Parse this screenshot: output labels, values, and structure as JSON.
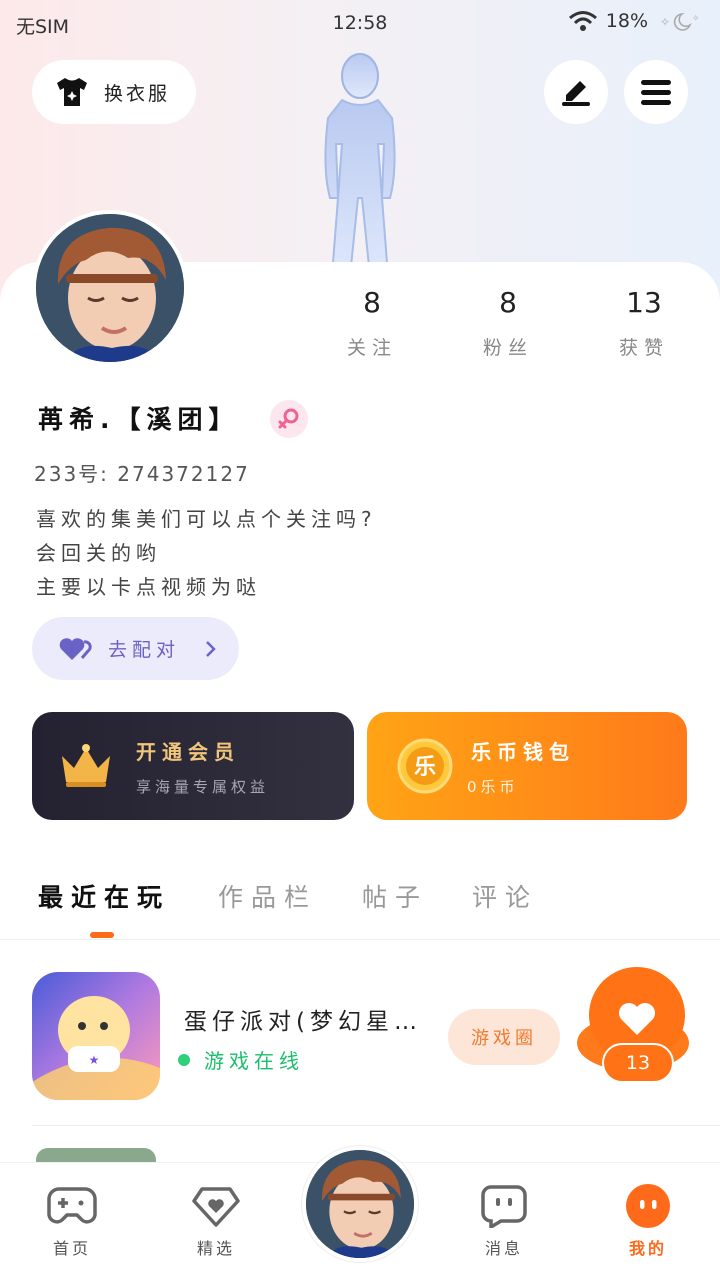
{
  "status_bar": {
    "carrier": "无SIM",
    "time": "12:58",
    "battery": "18%"
  },
  "header": {
    "outfit_label": "换衣服"
  },
  "profile": {
    "stats": [
      {
        "value": "8",
        "label": "关注"
      },
      {
        "value": "8",
        "label": "粉丝"
      },
      {
        "value": "13",
        "label": "获赞"
      }
    ],
    "name": "苒希.【溪团】",
    "uid": "233号: 274372127",
    "bio": [
      "喜欢的集美们可以点个关注吗?",
      "会回关的哟",
      "主要以卡点视频为哒"
    ],
    "match_label": "去配对"
  },
  "cards": {
    "vip": {
      "title": "开通会员",
      "subtitle": "享海量专属权益"
    },
    "wallet": {
      "title": "乐币钱包",
      "subtitle": "0乐币",
      "coin_glyph": "乐"
    }
  },
  "tabs": [
    "最近在玩",
    "作品栏",
    "帖子",
    "评论"
  ],
  "games": [
    {
      "name": "蛋仔派对(梦幻星…",
      "status": "游戏在线",
      "action": "游戏圈"
    }
  ],
  "like_float": {
    "count": "13"
  },
  "bottom_nav": [
    {
      "label": "首页",
      "icon": "gamepad-icon"
    },
    {
      "label": "精选",
      "icon": "heart-diamond-icon"
    },
    {
      "label": "消息",
      "icon": "chat-face-icon"
    },
    {
      "label": "我的",
      "icon": "profile-face-icon"
    }
  ],
  "colors": {
    "accent": "#ff6a1a",
    "online": "#1bbf6b",
    "match": "#6b62c6"
  }
}
